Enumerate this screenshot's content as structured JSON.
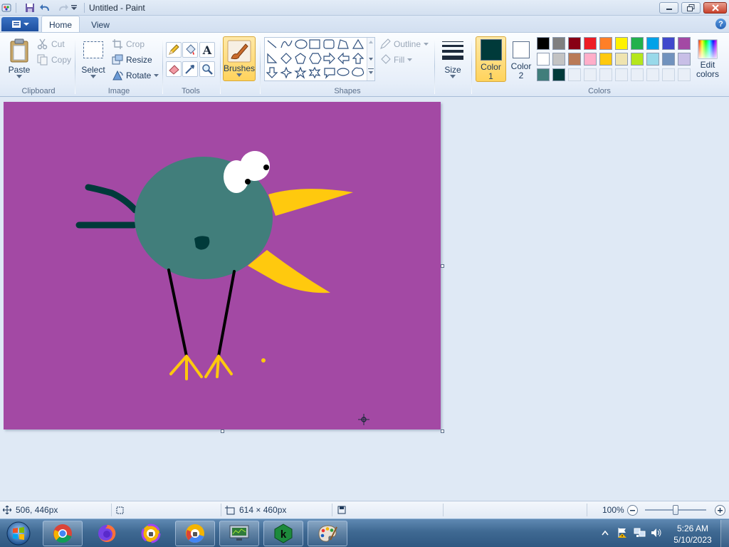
{
  "window": {
    "title": "Untitled - Paint",
    "controls": {
      "minimize": "minimize-icon",
      "restore": "restore-icon",
      "close": "close-icon"
    }
  },
  "quick_access": {
    "icons": [
      "paint-app-icon",
      "save-icon",
      "undo-icon",
      "redo-icon",
      "customize-dropdown-icon"
    ]
  },
  "tabs": [
    {
      "label": "Home",
      "active": true
    },
    {
      "label": "View",
      "active": false
    }
  ],
  "ribbon": {
    "clipboard": {
      "label": "Clipboard",
      "paste": "Paste",
      "cut": "Cut",
      "copy": "Copy"
    },
    "image": {
      "label": "Image",
      "select": "Select",
      "crop": "Crop",
      "resize": "Resize",
      "rotate": "Rotate"
    },
    "tools": {
      "label": "Tools"
    },
    "brushes": {
      "label": "Brushes"
    },
    "shapes": {
      "label": "Shapes",
      "outline": "Outline",
      "fill": "Fill"
    },
    "size": {
      "label": "Size"
    },
    "color1": {
      "label_line1": "Color",
      "label_line2": "1",
      "value": "#003a3a"
    },
    "color2": {
      "label_line1": "Color",
      "label_line2": "2",
      "value": "#ffffff"
    },
    "colors": {
      "label": "Colors",
      "row1": [
        "#000000",
        "#7f7f7f",
        "#880015",
        "#ed1c24",
        "#ff7f27",
        "#fff200",
        "#22b14c",
        "#00a2e8",
        "#3f48cc",
        "#a349a4"
      ],
      "row2": [
        "#ffffff",
        "#c3c3c3",
        "#b97a57",
        "#ffaec9",
        "#ffc90e",
        "#efe4b0",
        "#b5e61d",
        "#99d9ea",
        "#7092be",
        "#c8bfe7"
      ],
      "row3": [
        "#417e7b",
        "#003a3a"
      ],
      "edit_line1": "Edit",
      "edit_line2": "colors"
    }
  },
  "canvas": {
    "background": "#a349a4",
    "accent_colors": {
      "body": "#417e7b",
      "dark": "#003a3a",
      "beak": "#ffc90e",
      "legs": "#000000"
    }
  },
  "status": {
    "cursor_pos": "506, 446px",
    "selection_size": "",
    "canvas_size": "614 × 460px",
    "zoom": "100%",
    "zoom_level": 0.5
  },
  "taskbar": {
    "apps": [
      "start-orb-icon",
      "chrome-icon",
      "firefox-icon",
      "private-browser-icon",
      "chromium-icon",
      "monitor-app-icon",
      "k-app-icon",
      "paint-palette-icon"
    ],
    "time": "5:26 AM",
    "date": "5/10/2023"
  }
}
